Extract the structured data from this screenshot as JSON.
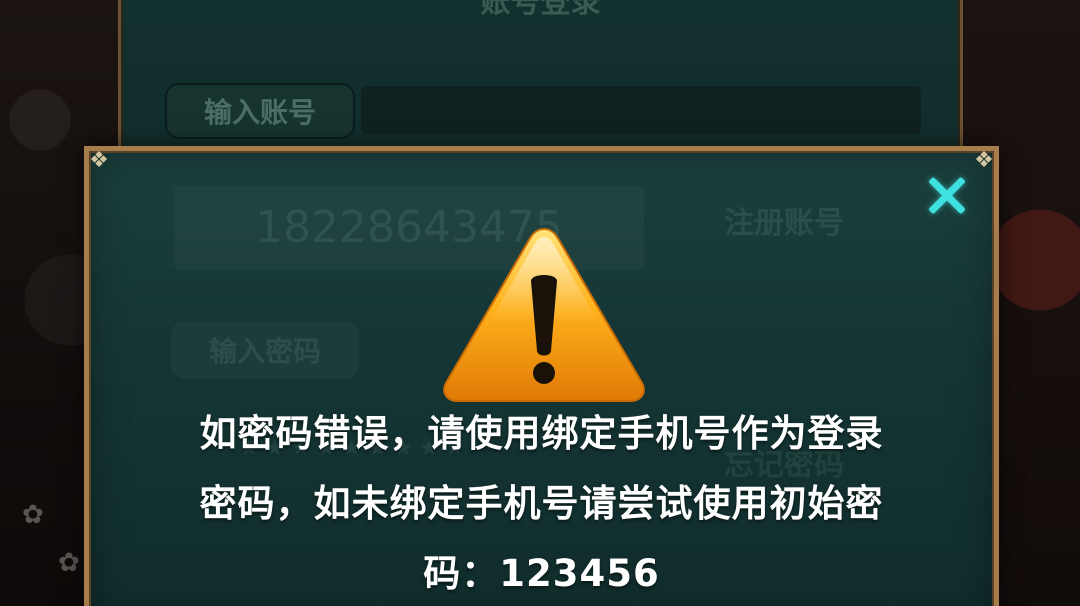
{
  "login_panel": {
    "title": "账号登录",
    "account_label": "输入账号",
    "close_icon": "close-icon"
  },
  "ghost": {
    "phone": "18228643475",
    "register": "注册账号",
    "password_label": "输入密码",
    "password_mask": "★★★★★★★★★",
    "forgot": "忘记密码"
  },
  "dialog": {
    "icon": "warning-icon",
    "close_icon": "close-icon",
    "message_line1": "如密码错误，请使用绑定手机号作为登录",
    "message_line2": "密码，如未绑定手机号请尝试使用初始密",
    "message_line3": "码：123456",
    "accent_color": "#3fe0e0",
    "border_color": "#a77d4c"
  }
}
